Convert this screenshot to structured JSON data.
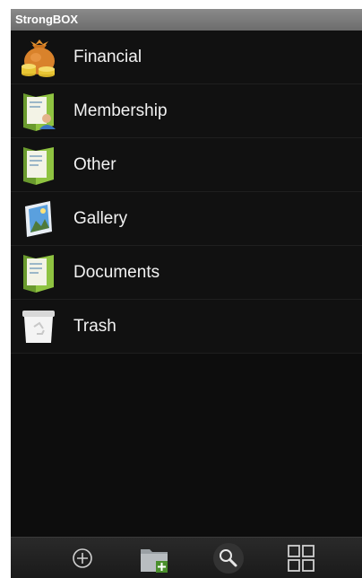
{
  "app": {
    "title": "StrongBOX"
  },
  "categories": [
    {
      "label": "Financial",
      "icon": "money-bag-icon"
    },
    {
      "label": "Membership",
      "icon": "folder-contact-icon"
    },
    {
      "label": "Other",
      "icon": "folder-document-icon"
    },
    {
      "label": "Gallery",
      "icon": "gallery-picture-icon"
    },
    {
      "label": "Documents",
      "icon": "folder-document-icon"
    },
    {
      "label": "Trash",
      "icon": "trash-bin-icon"
    }
  ],
  "toolbar": {
    "buttons": [
      {
        "name": "add-button",
        "icon": "plus-circle-icon"
      },
      {
        "name": "new-folder-button",
        "icon": "folder-add-icon"
      },
      {
        "name": "search-button",
        "icon": "search-icon"
      },
      {
        "name": "grid-view-button",
        "icon": "grid-icon"
      }
    ]
  },
  "colors": {
    "background": "#0d0d0d",
    "titlebar": "#7a7a7a",
    "text": "#f2f2f2"
  }
}
